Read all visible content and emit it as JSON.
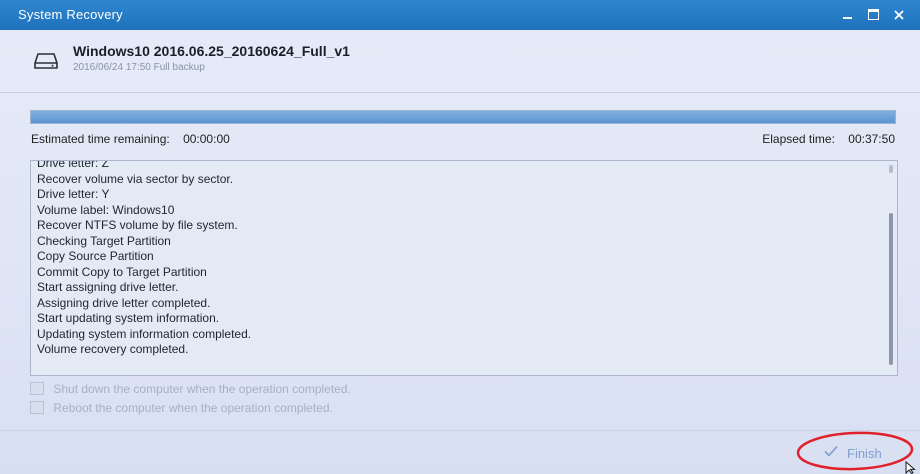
{
  "window": {
    "title": "System Recovery"
  },
  "header": {
    "job_name": "Windows10 2016.06.25_20160624_Full_v1",
    "job_subtitle": "2016/06/24 17:50 Full backup"
  },
  "progress": {
    "fraction": 1.0
  },
  "time": {
    "remaining_label": "Estimated time remaining:",
    "remaining_value": "00:00:00",
    "elapsed_label": "Elapsed time:",
    "elapsed_value": "00:37:50"
  },
  "log": {
    "lines": [
      "Drive letter: Z",
      "Recover volume via sector by sector.",
      "Drive letter: Y",
      "Volume label: Windows10",
      "Recover NTFS volume by file system.",
      "Checking Target Partition",
      "Copy Source Partition",
      "Commit Copy to Target Partition",
      "Start assigning drive letter.",
      "Assigning drive letter completed.",
      "Start updating system information.",
      "Updating system information completed.",
      "Volume recovery completed."
    ]
  },
  "options": {
    "shutdown_label": "Shut down the computer when the operation completed.",
    "reboot_label": "Reboot the computer when the operation completed.",
    "shutdown_checked": false,
    "reboot_checked": false
  },
  "footer": {
    "finish_label": "Finish"
  },
  "colors": {
    "titlebar": "#1f72bd",
    "progress": "#5c95cf",
    "highlight": "#e0202a",
    "finish_text": "#7f9fcc"
  },
  "icons": {
    "drive": "hard-drive-icon",
    "finish": "checkmark-icon"
  }
}
